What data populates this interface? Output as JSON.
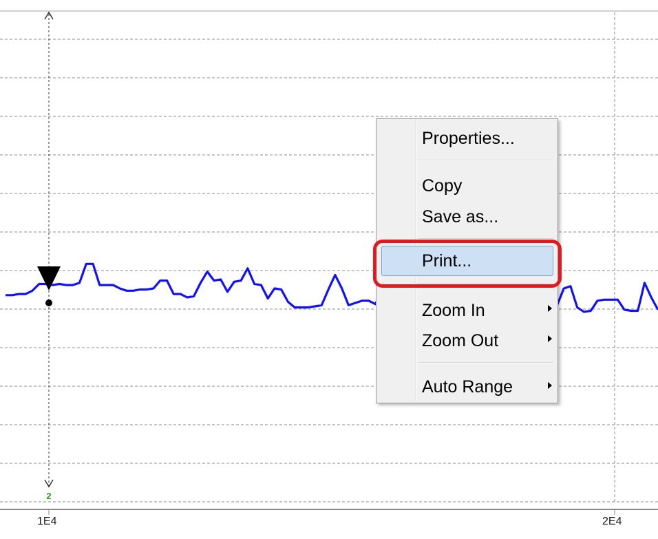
{
  "axis": {
    "x_tick_labels": [
      "1E4",
      "2E4"
    ],
    "cursor_label": "2"
  },
  "colors": {
    "series": "#1010ff",
    "grid": "#8a8a8a",
    "highlight": "#e3191f"
  },
  "context_menu": {
    "items": {
      "properties": "Properties...",
      "copy": "Copy",
      "save_as": "Save as...",
      "print": "Print...",
      "zoom_in": "Zoom In",
      "zoom_out": "Zoom Out",
      "auto_range": "Auto Range"
    },
    "highlighted_item": "print"
  },
  "chart_data": {
    "type": "line",
    "series": [
      {
        "values": [
          0.5,
          0.5,
          0.51,
          0.51,
          0.54,
          0.6,
          0.6,
          0.59,
          0.6,
          0.59,
          0.59,
          0.61,
          0.78,
          0.78,
          0.59,
          0.59,
          0.59,
          0.56,
          0.54,
          0.54,
          0.55,
          0.55,
          0.56,
          0.63,
          0.63,
          0.51,
          0.51,
          0.48,
          0.49,
          0.61,
          0.71,
          0.63,
          0.64,
          0.53,
          0.62,
          0.63,
          0.74,
          0.6,
          0.59,
          0.47,
          0.56,
          0.55,
          0.44,
          0.39,
          0.39,
          0.39,
          0.4,
          0.41,
          0.55,
          0.68,
          0.56,
          0.41,
          0.43,
          0.45,
          0.45,
          0.42,
          0.55,
          0.55,
          0.72,
          0.61,
          0.4,
          0.4,
          0.4,
          0.4,
          0.41,
          0.41,
          0.41,
          0.41,
          0.41,
          0.41,
          0.42,
          0.43,
          0.44,
          0.47,
          0.51,
          0.48,
          0.46,
          0.55,
          0.56,
          0.51,
          0.42,
          0.41,
          0.41,
          0.56,
          0.58,
          0.39,
          0.35,
          0.36,
          0.45,
          0.46,
          0.46,
          0.46,
          0.37,
          0.36,
          0.36,
          0.61,
          0.48,
          0.37
        ]
      }
    ]
  }
}
